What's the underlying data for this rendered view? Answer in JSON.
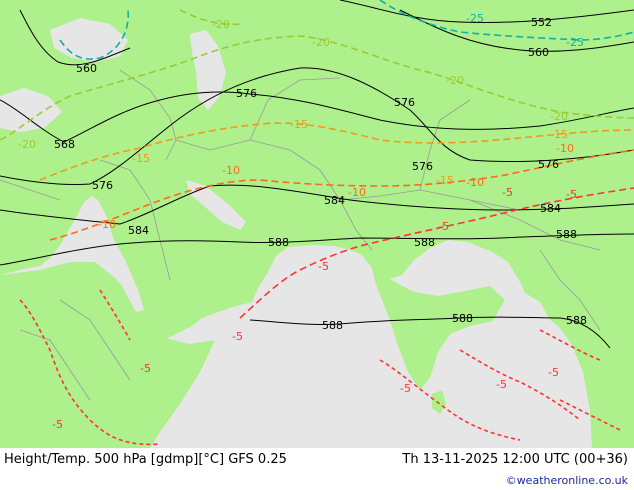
{
  "footer": {
    "title": "Height/Temp. 500 hPa [gdmp][°C] GFS 0.25",
    "datetime": "Th 13-11-2025 12:00 UTC (00+36)",
    "credit": "©weatheronline.co.uk"
  },
  "colors": {
    "land": "#aef08c",
    "sea": "#e6e6e6",
    "border": "#9a9a9a",
    "height_contour": "#000000",
    "temp_minus5": "#ff3333",
    "temp_minus10": "#ff6a1a",
    "temp_minus15": "#f09a1e",
    "temp_minus20": "#99cc33",
    "temp_minus25": "#11b0a0",
    "credit": "#1a2a99"
  },
  "height_labels": [
    "552",
    "560",
    "560",
    "568",
    "576",
    "576",
    "576",
    "576",
    "576",
    "584",
    "584",
    "584",
    "588",
    "588",
    "588",
    "588",
    "588",
    "588"
  ],
  "temp_labels": [
    "-25",
    "-25",
    "-20",
    "-20",
    "-20",
    "-20",
    "-20",
    "-15",
    "-15",
    "-15",
    "-15",
    "-10",
    "-10",
    "-10",
    "-10",
    "-10",
    "-5",
    "-5",
    "-5",
    "-5",
    "-5",
    "-5",
    "-5",
    "-5",
    "-5",
    "-5"
  ]
}
